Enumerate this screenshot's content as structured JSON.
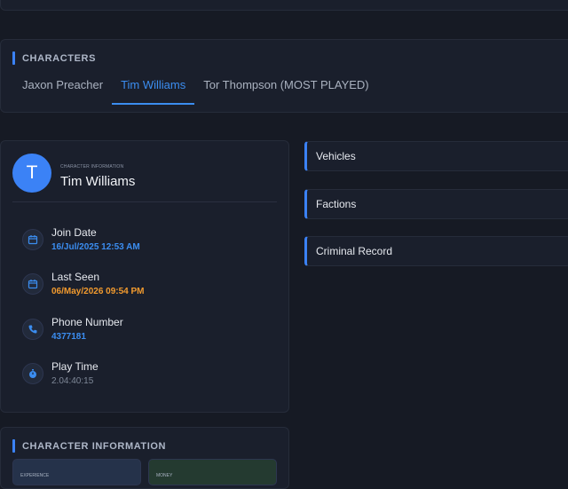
{
  "characters": {
    "section_title": "CHARACTERS",
    "tabs": [
      {
        "label": "Jaxon Preacher",
        "active": false
      },
      {
        "label": "Tim Williams",
        "active": true
      },
      {
        "label": "Tor Thompson (MOST PLAYED)",
        "active": false
      }
    ]
  },
  "profile": {
    "avatar_letter": "T",
    "caption": "CHARACTER INFORMATION",
    "name": "Tim Williams",
    "rows": [
      {
        "label": "Join Date",
        "value": "16/Jul/2025 12:53 AM",
        "icon": "calendar-icon"
      },
      {
        "label": "Last Seen",
        "value": "06/May/2026 09:54 PM",
        "icon": "calendar-icon"
      },
      {
        "label": "Phone Number",
        "value": "4377181",
        "icon": "phone-icon"
      },
      {
        "label": "Play Time",
        "value": "2.04:40:15",
        "icon": "stopwatch-icon"
      }
    ]
  },
  "sections": [
    "Vehicles",
    "Factions",
    "Criminal Record"
  ],
  "character_info": {
    "section_title": "CHARACTER INFORMATION",
    "cards": [
      {
        "label": "EXPERIENCE"
      },
      {
        "label": "MONEY"
      }
    ]
  },
  "colors": {
    "accent": "#3b82f6",
    "last_seen": "#f29a2e",
    "background": "#161a24",
    "panel": "#1a1f2c"
  }
}
